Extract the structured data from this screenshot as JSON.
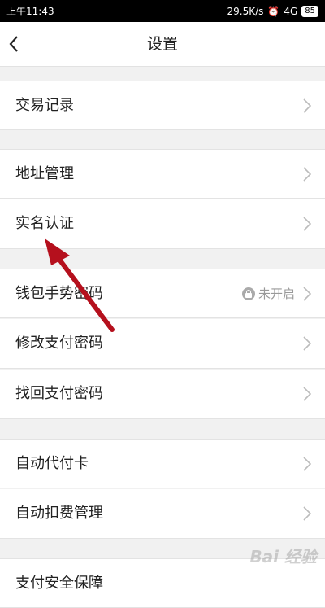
{
  "status_bar": {
    "time": "上午11:43",
    "net_speed": "29.5K/s",
    "network": "4G",
    "battery": "85"
  },
  "header": {
    "title": "设置"
  },
  "sections": {
    "transaction_record": "交易记录",
    "address_management": "地址管理",
    "real_name_verification": "实名认证",
    "wallet_gesture_password": "钱包手势密码",
    "wallet_gesture_status": "未开启",
    "change_payment_password": "修改支付密码",
    "recover_payment_password": "找回支付密码",
    "auto_pay_card": "自动代付卡",
    "auto_debit_management": "自动扣费管理",
    "partial_next_item": "支付安全保障"
  },
  "watermark": "Bai 经验",
  "colors": {
    "annotation_arrow": "#b5101d"
  }
}
